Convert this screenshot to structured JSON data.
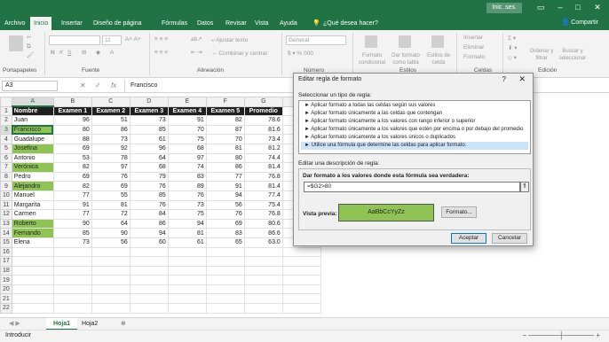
{
  "tabs": [
    "Archivo",
    "Inicio",
    "Insertar",
    "Diseño de página",
    "Fórmulas",
    "Datos",
    "Revisar",
    "Vista",
    "Ayuda",
    "¿Qué desea hacer?"
  ],
  "signin": "Inic. ses.",
  "share": "Compartir",
  "ribbon": {
    "groups": [
      "Portapapeles",
      "Fuente",
      "Alineación",
      "Número",
      "Estilos",
      "Celdas",
      "Edición"
    ],
    "wrap_text": "Ajustar texto",
    "merge": "Combinar y centrar",
    "number_format": "General",
    "styles": [
      "Formato condicional",
      "Dar formato como tabla",
      "Estilos de celda"
    ],
    "cells": [
      "Insertar",
      "Eliminar",
      "Formato"
    ],
    "edit": [
      "Ordenar y filtrar",
      "Buscar y seleccionar"
    ]
  },
  "formula_bar": {
    "name_box": "A3",
    "fx": "fx",
    "value": "Francisco"
  },
  "grid": {
    "columns": [
      "A",
      "B",
      "C",
      "D",
      "E",
      "F",
      "G",
      "H"
    ],
    "header": [
      "Nombre",
      "Examen 1",
      "Examen 2",
      "Examen 3",
      "Examen 4",
      "Examen 5",
      "Promedio"
    ],
    "rows": [
      [
        "Juan",
        "96",
        "51",
        "73",
        "91",
        "82",
        "78.6"
      ],
      [
        "Francisco",
        "80",
        "86",
        "85",
        "70",
        "87",
        "81.6"
      ],
      [
        "Guadalupe",
        "88",
        "73",
        "61",
        "75",
        "70",
        "73.4"
      ],
      [
        "Josefina",
        "69",
        "92",
        "96",
        "68",
        "81",
        "81.2"
      ],
      [
        "Antonio",
        "53",
        "78",
        "64",
        "97",
        "80",
        "74.4"
      ],
      [
        "Verónica",
        "82",
        "97",
        "68",
        "74",
        "86",
        "81.4"
      ],
      [
        "Pedro",
        "69",
        "76",
        "79",
        "83",
        "77",
        "76.8"
      ],
      [
        "Alejandro",
        "82",
        "69",
        "76",
        "89",
        "91",
        "81.4"
      ],
      [
        "Manuel",
        "77",
        "55",
        "85",
        "76",
        "94",
        "77.4"
      ],
      [
        "Margarita",
        "91",
        "81",
        "76",
        "73",
        "56",
        "75.4"
      ],
      [
        "Carmen",
        "77",
        "72",
        "84",
        "75",
        "76",
        "76.8"
      ],
      [
        "Roberto",
        "90",
        "64",
        "86",
        "94",
        "69",
        "80.6"
      ],
      [
        "Fernando",
        "85",
        "90",
        "94",
        "81",
        "83",
        "86.6"
      ],
      [
        "Elena",
        "73",
        "56",
        "60",
        "61",
        "65",
        "63.0"
      ]
    ],
    "highlighted_rows": [
      1,
      3,
      5,
      7,
      11,
      12
    ]
  },
  "sheets": [
    "Hoja1",
    "Hoja2"
  ],
  "status": "Introducir",
  "dialog": {
    "title": "Editar regla de formato",
    "help": "?",
    "close": "✕",
    "select_label": "Seleccionar un tipo de regla:",
    "rule_types": [
      "► Aplicar formato a todas las celdas según sus valores",
      "► Aplicar formato únicamente a las celdas que contengan",
      "► Aplicar formato únicamente a los valores con rango inferior o superior",
      "► Aplicar formato únicamente a los valores que estén por encima o por debajo del promedio",
      "► Aplicar formato únicamente a los valores únicos o duplicados",
      "► Utilice una fórmula que determine las celdas para aplicar formato."
    ],
    "edit_label": "Editar una descripción de regla:",
    "formula_label": "Dar formato a los valores donde esta fórmula sea verdadera:",
    "formula": "=$G2>80",
    "preview_label": "Vista previa:",
    "preview_text": "AaBbCcYyZz",
    "format_button": "Formato...",
    "ok": "Aceptar",
    "cancel": "Cancelar"
  },
  "colors": {
    "excel_green": "#217346",
    "highlight_green": "#8fc454",
    "header_dark": "#1f1f1f"
  }
}
